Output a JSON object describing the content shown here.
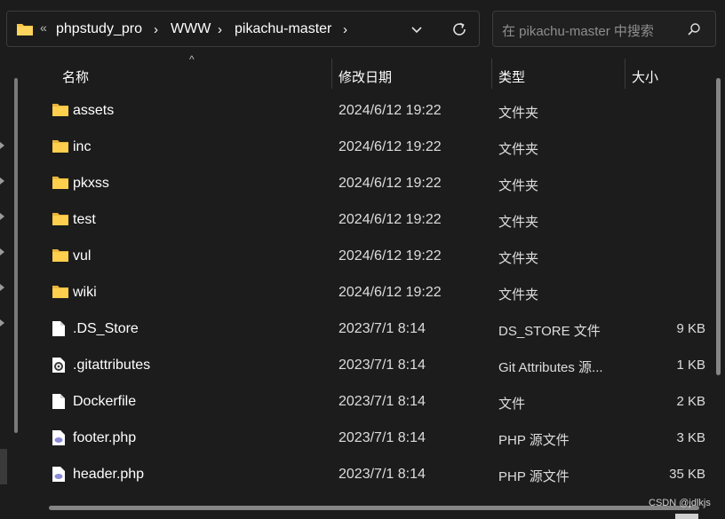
{
  "address_bar": {
    "overflow": "«",
    "breadcrumbs": [
      "phpstudy_pro",
      "WWW",
      "pikachu-master"
    ],
    "folder_icon": "folder-icon",
    "dropdown_icon": "chevron-down-icon",
    "refresh_icon": "refresh-icon"
  },
  "search": {
    "placeholder": "在 pikachu-master 中搜索",
    "icon": "search-icon"
  },
  "columns": {
    "name": "名称",
    "date": "修改日期",
    "type": "类型",
    "size": "大小"
  },
  "files": [
    {
      "name": "assets",
      "date": "2024/6/12 19:22",
      "type": "文件夹",
      "size": "",
      "icon": "folder-icon"
    },
    {
      "name": "inc",
      "date": "2024/6/12 19:22",
      "type": "文件夹",
      "size": "",
      "icon": "folder-icon"
    },
    {
      "name": "pkxss",
      "date": "2024/6/12 19:22",
      "type": "文件夹",
      "size": "",
      "icon": "folder-icon"
    },
    {
      "name": "test",
      "date": "2024/6/12 19:22",
      "type": "文件夹",
      "size": "",
      "icon": "folder-icon"
    },
    {
      "name": "vul",
      "date": "2024/6/12 19:22",
      "type": "文件夹",
      "size": "",
      "icon": "folder-icon"
    },
    {
      "name": "wiki",
      "date": "2024/6/12 19:22",
      "type": "文件夹",
      "size": "",
      "icon": "folder-icon"
    },
    {
      "name": ".DS_Store",
      "date": "2023/7/1 8:14",
      "type": "DS_STORE 文件",
      "size": "9 KB",
      "icon": "file-icon"
    },
    {
      "name": ".gitattributes",
      "date": "2023/7/1 8:14",
      "type": "Git Attributes 源...",
      "size": "1 KB",
      "icon": "gear-file-icon"
    },
    {
      "name": "Dockerfile",
      "date": "2023/7/1 8:14",
      "type": "文件",
      "size": "2 KB",
      "icon": "file-icon"
    },
    {
      "name": "footer.php",
      "date": "2023/7/1 8:14",
      "type": "PHP 源文件",
      "size": "3 KB",
      "icon": "php-file-icon"
    },
    {
      "name": "header.php",
      "date": "2023/7/1 8:14",
      "type": "PHP 源文件",
      "size": "35 KB",
      "icon": "php-file-icon"
    }
  ],
  "watermark": "CSDN @jdlkjs",
  "colors": {
    "background": "#1c1c1c",
    "folder": "#f6c544",
    "text": "#ffffff"
  }
}
